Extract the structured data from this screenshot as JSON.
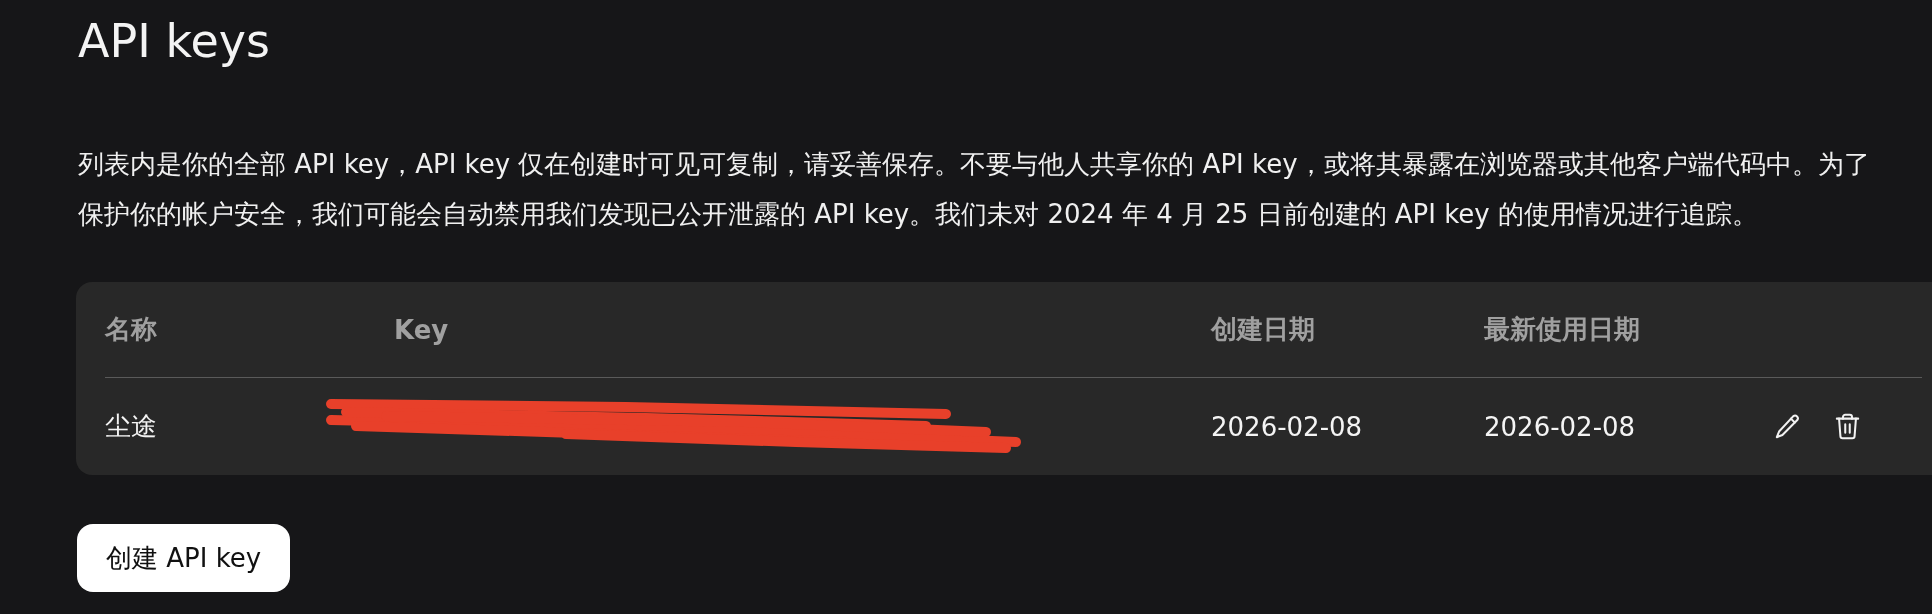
{
  "page_title": "API keys",
  "description": {
    "lines": [
      "列表内是你的全部 API key，API key 仅在创建时可见可复制，请妥善保存。不要与他人共享你的 API key，或将其暴露在浏览器或其他客户端代码中。为了",
      "保护你的帐户安全，我们可能会自动禁用我们发现已公开泄露的 API key。我们未对 2024 年 4 月 25 日前创建的 API key 的使用情况进行追踪。"
    ]
  },
  "table": {
    "columns": [
      "名称",
      "Key",
      "创建日期",
      "最新使用日期"
    ],
    "rows": [
      {
        "name": "尘途",
        "key_redacted": true,
        "created": "2026-02-08",
        "last_used": "2026-02-08"
      }
    ]
  },
  "create_button": {
    "label": "创建 API key"
  }
}
